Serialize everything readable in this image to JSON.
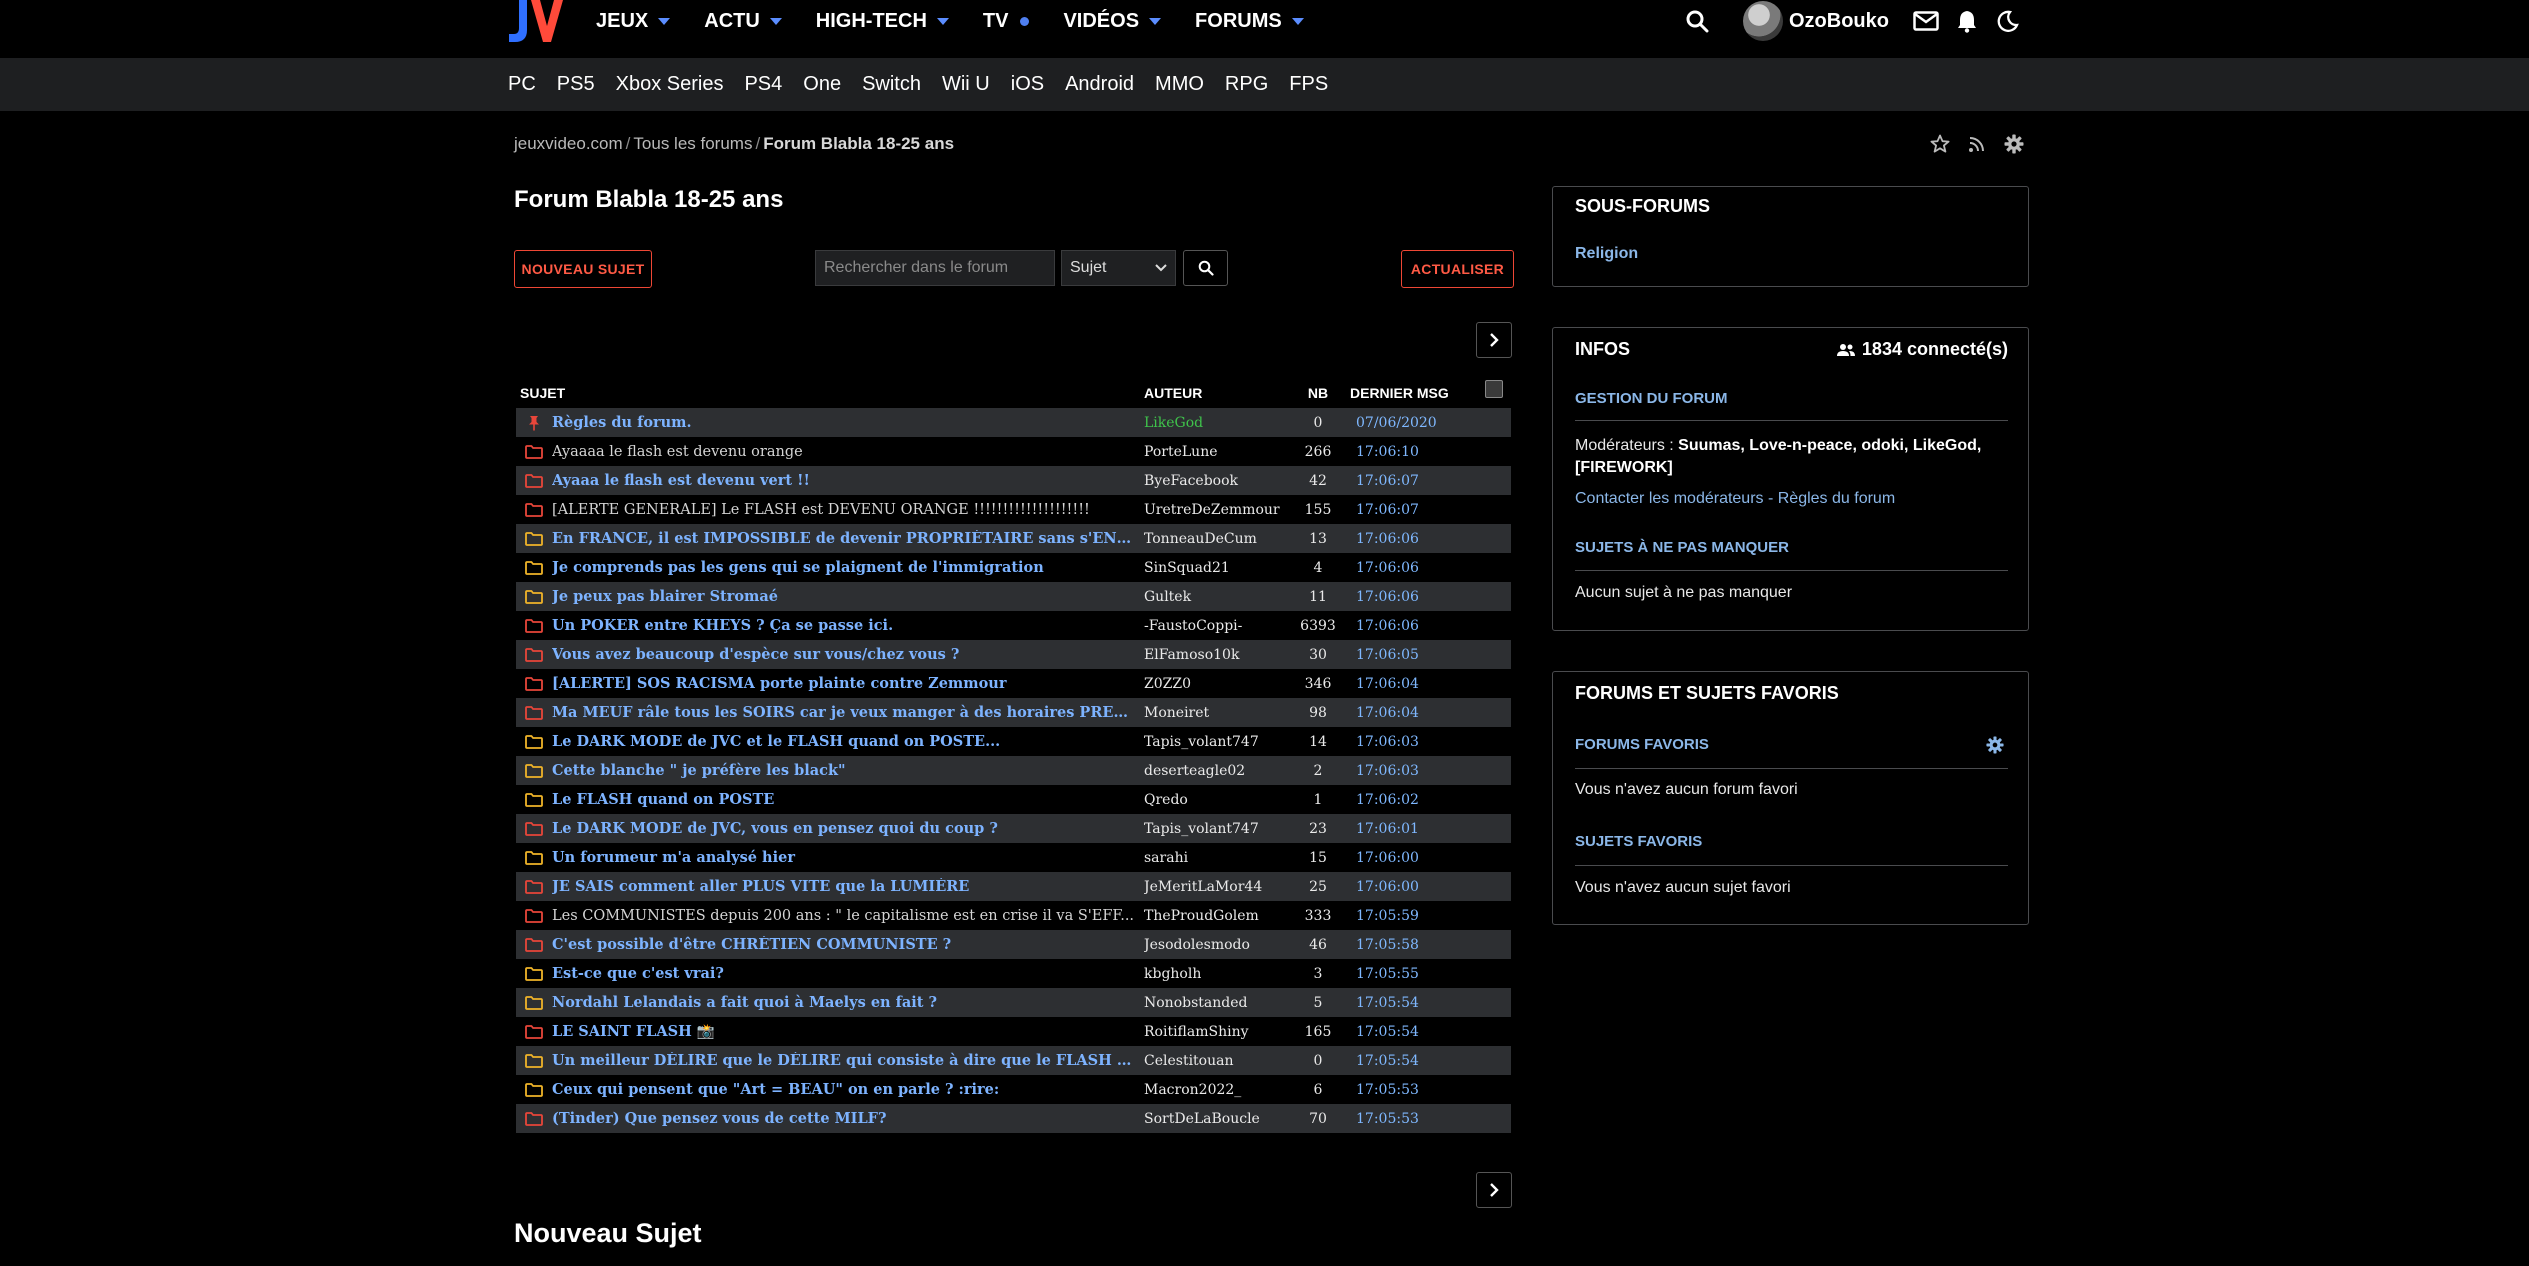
{
  "brand": {
    "logo_text": "JV"
  },
  "main_nav": [
    {
      "label": "JEUX",
      "marker": "caret"
    },
    {
      "label": "ACTU",
      "marker": "caret"
    },
    {
      "label": "HIGH-TECH",
      "marker": "caret"
    },
    {
      "label": "TV",
      "marker": "dot"
    },
    {
      "label": "VIDÉOS",
      "marker": "caret"
    },
    {
      "label": "FORUMS",
      "marker": "caret"
    }
  ],
  "user": {
    "name": "OzoBouko"
  },
  "platforms": [
    "PC",
    "PS5",
    "Xbox Series",
    "PS4",
    "One",
    "Switch",
    "Wii U",
    "iOS",
    "Android",
    "MMO",
    "RPG",
    "FPS"
  ],
  "breadcrumb": {
    "root": "jeuxvideo.com",
    "sep": "/",
    "middle": "Tous les forums",
    "current": "Forum Blabla 18-25 ans"
  },
  "page": {
    "title": "Forum Blabla 18-25 ans",
    "new_subject_title": "Nouveau Sujet"
  },
  "actions": {
    "new_topic": "NOUVEAU SUJET",
    "refresh": "ACTUALISER",
    "search_placeholder": "Rechercher dans le forum",
    "search_scope": "Sujet"
  },
  "table": {
    "headers": {
      "subject": "SUJET",
      "author": "AUTEUR",
      "count": "NB",
      "last": "DERNIER MSG"
    },
    "rows": [
      {
        "icon": "pin",
        "subject": "Règles du forum.",
        "author": "LikeGod",
        "count": "0",
        "last": "07/06/2020",
        "hot": true,
        "mod": true
      },
      {
        "icon": "red",
        "subject": "Ayaaaa le flash est devenu orange",
        "author": "PorteLune",
        "count": "266",
        "last": "17:06:10",
        "hot": false
      },
      {
        "icon": "red",
        "subject": "Ayaaa le flash est devenu vert !!",
        "author": "ByeFacebook",
        "count": "42",
        "last": "17:06:07",
        "hot": true
      },
      {
        "icon": "red",
        "subject": "[ALERTE GENERALE] Le FLASH est DEVENU ORANGE !!!!!!!!!!!!!!!!!!!!",
        "author": "UretreDeZemmour",
        "count": "155",
        "last": "17:06:07",
        "hot": false
      },
      {
        "icon": "yellow",
        "subject": "En FRANCE, il est IMPOSSIBLE de devenir PROPRIÉTAIRE sans s'ENDETTE...",
        "author": "TonneauDeCum",
        "count": "13",
        "last": "17:06:06",
        "hot": true
      },
      {
        "icon": "yellow",
        "subject": "Je comprends pas les gens qui se plaignent de l'immigration",
        "author": "SinSquad21",
        "count": "4",
        "last": "17:06:06",
        "hot": true
      },
      {
        "icon": "yellow",
        "subject": "Je peux pas blairer Stromaé",
        "author": "Gultek",
        "count": "11",
        "last": "17:06:06",
        "hot": true
      },
      {
        "icon": "red",
        "subject": "Un POKER entre KHEYS ? Ça se passe ici.",
        "author": "-FaustoCoppi-",
        "count": "6393",
        "last": "17:06:06",
        "hot": true
      },
      {
        "icon": "red",
        "subject": "Vous avez beaucoup d'espèce sur vous/chez vous ?",
        "author": "ElFamoso10k",
        "count": "30",
        "last": "17:06:05",
        "hot": true
      },
      {
        "icon": "red",
        "subject": "[ALERTE] SOS RACISMA porte plainte contre Zemmour",
        "author": "Z0ZZ0",
        "count": "346",
        "last": "17:06:04",
        "hot": true
      },
      {
        "icon": "red",
        "subject": "Ma MEUF râle tous les SOIRS car je veux manger à des horaires PRECIS",
        "author": "Moneiret",
        "count": "98",
        "last": "17:06:04",
        "hot": true
      },
      {
        "icon": "yellow",
        "subject": "Le DARK MODE de JVC et le FLASH quand on POSTE...",
        "author": "Tapis_volant747",
        "count": "14",
        "last": "17:06:03",
        "hot": true
      },
      {
        "icon": "yellow",
        "subject": "Cette blanche \" je préfère les black\"",
        "author": "deserteagle02",
        "count": "2",
        "last": "17:06:03",
        "hot": true
      },
      {
        "icon": "yellow",
        "subject": "Le FLASH quand on POSTE",
        "author": "Qredo",
        "count": "1",
        "last": "17:06:02",
        "hot": true
      },
      {
        "icon": "red",
        "subject": "Le DARK MODE de JVC, vous en pensez quoi du coup ?",
        "author": "Tapis_volant747",
        "count": "23",
        "last": "17:06:01",
        "hot": true
      },
      {
        "icon": "yellow",
        "subject": "Un forumeur m'a analysé hier",
        "author": "sarahi",
        "count": "15",
        "last": "17:06:00",
        "hot": true
      },
      {
        "icon": "red",
        "subject": "JE SAIS comment aller PLUS VITE que la LUMIÈRE",
        "author": "JeMeritLaMor44",
        "count": "25",
        "last": "17:06:00",
        "hot": true
      },
      {
        "icon": "red",
        "subject": "Les COMMUNISTES depuis 200 ans : \" le capitalisme est en crise il va S'EFF...",
        "author": "TheProudGolem",
        "count": "333",
        "last": "17:05:59",
        "hot": false
      },
      {
        "icon": "red",
        "subject": "C'est possible d'être CHRÉTIEN COMMUNISTE ?",
        "author": "Jesodolesmodo",
        "count": "46",
        "last": "17:05:58",
        "hot": true
      },
      {
        "icon": "yellow",
        "subject": "Est-ce que c'est vrai?",
        "author": "kbgholh",
        "count": "3",
        "last": "17:05:55",
        "hot": true
      },
      {
        "icon": "yellow",
        "subject": "Nordahl Lelandais a fait quoi à Maelys en fait ?",
        "author": "Nonobstanded",
        "count": "5",
        "last": "17:05:54",
        "hot": true
      },
      {
        "icon": "red",
        "subject": "LE SAINT FLASH 📸",
        "author": "RoitiflamShiny",
        "count": "165",
        "last": "17:05:54",
        "hot": true
      },
      {
        "icon": "yellow",
        "subject": "Un meilleur DÉLIRE que le DÉLIRE qui consiste à dire que le FLASH est un ...",
        "author": "Celestitouan",
        "count": "0",
        "last": "17:05:54",
        "hot": true
      },
      {
        "icon": "yellow",
        "subject": "Ceux qui pensent que \"Art = BEAU\" on en parle ? :rire:",
        "author": "Macron2022_",
        "count": "6",
        "last": "17:05:53",
        "hot": true
      },
      {
        "icon": "red",
        "subject": "(Tinder) Que pensez vous de cette MILF?",
        "author": "SortDeLaBoucle",
        "count": "70",
        "last": "17:05:53",
        "hot": true
      }
    ]
  },
  "sidebar": {
    "subforums": {
      "title": "SOUS-FORUMS",
      "items": [
        "Religion"
      ]
    },
    "infos": {
      "title": "INFOS",
      "online": "1834 connecté(s)",
      "manage_title": "GESTION DU FORUM",
      "mods_label": "Modérateurs :",
      "mods": "Suumas, Love-n-peace, odoki, LikeGod,",
      "mods2": "[FIREWORK]",
      "links": "Contacter les modérateurs - Règles du forum",
      "must_title": "SUJETS À NE PAS MANQUER",
      "must_text": "Aucun sujet à ne pas manquer"
    },
    "favorites": {
      "title": "FORUMS ET SUJETS FAVORIS",
      "forums_title": "FORUMS FAVORIS",
      "forums_text": "Vous n'avez aucun forum favori",
      "topics_title": "SUJETS FAVORIS",
      "topics_text": "Vous n'avez aucun sujet favori"
    }
  },
  "colors": {
    "accent_red": "#ee4735",
    "link_blue": "#7db3ff",
    "folder_red": "#e8463a",
    "folder_yellow": "#f0b429",
    "moderator_green": "#3fc34b"
  }
}
